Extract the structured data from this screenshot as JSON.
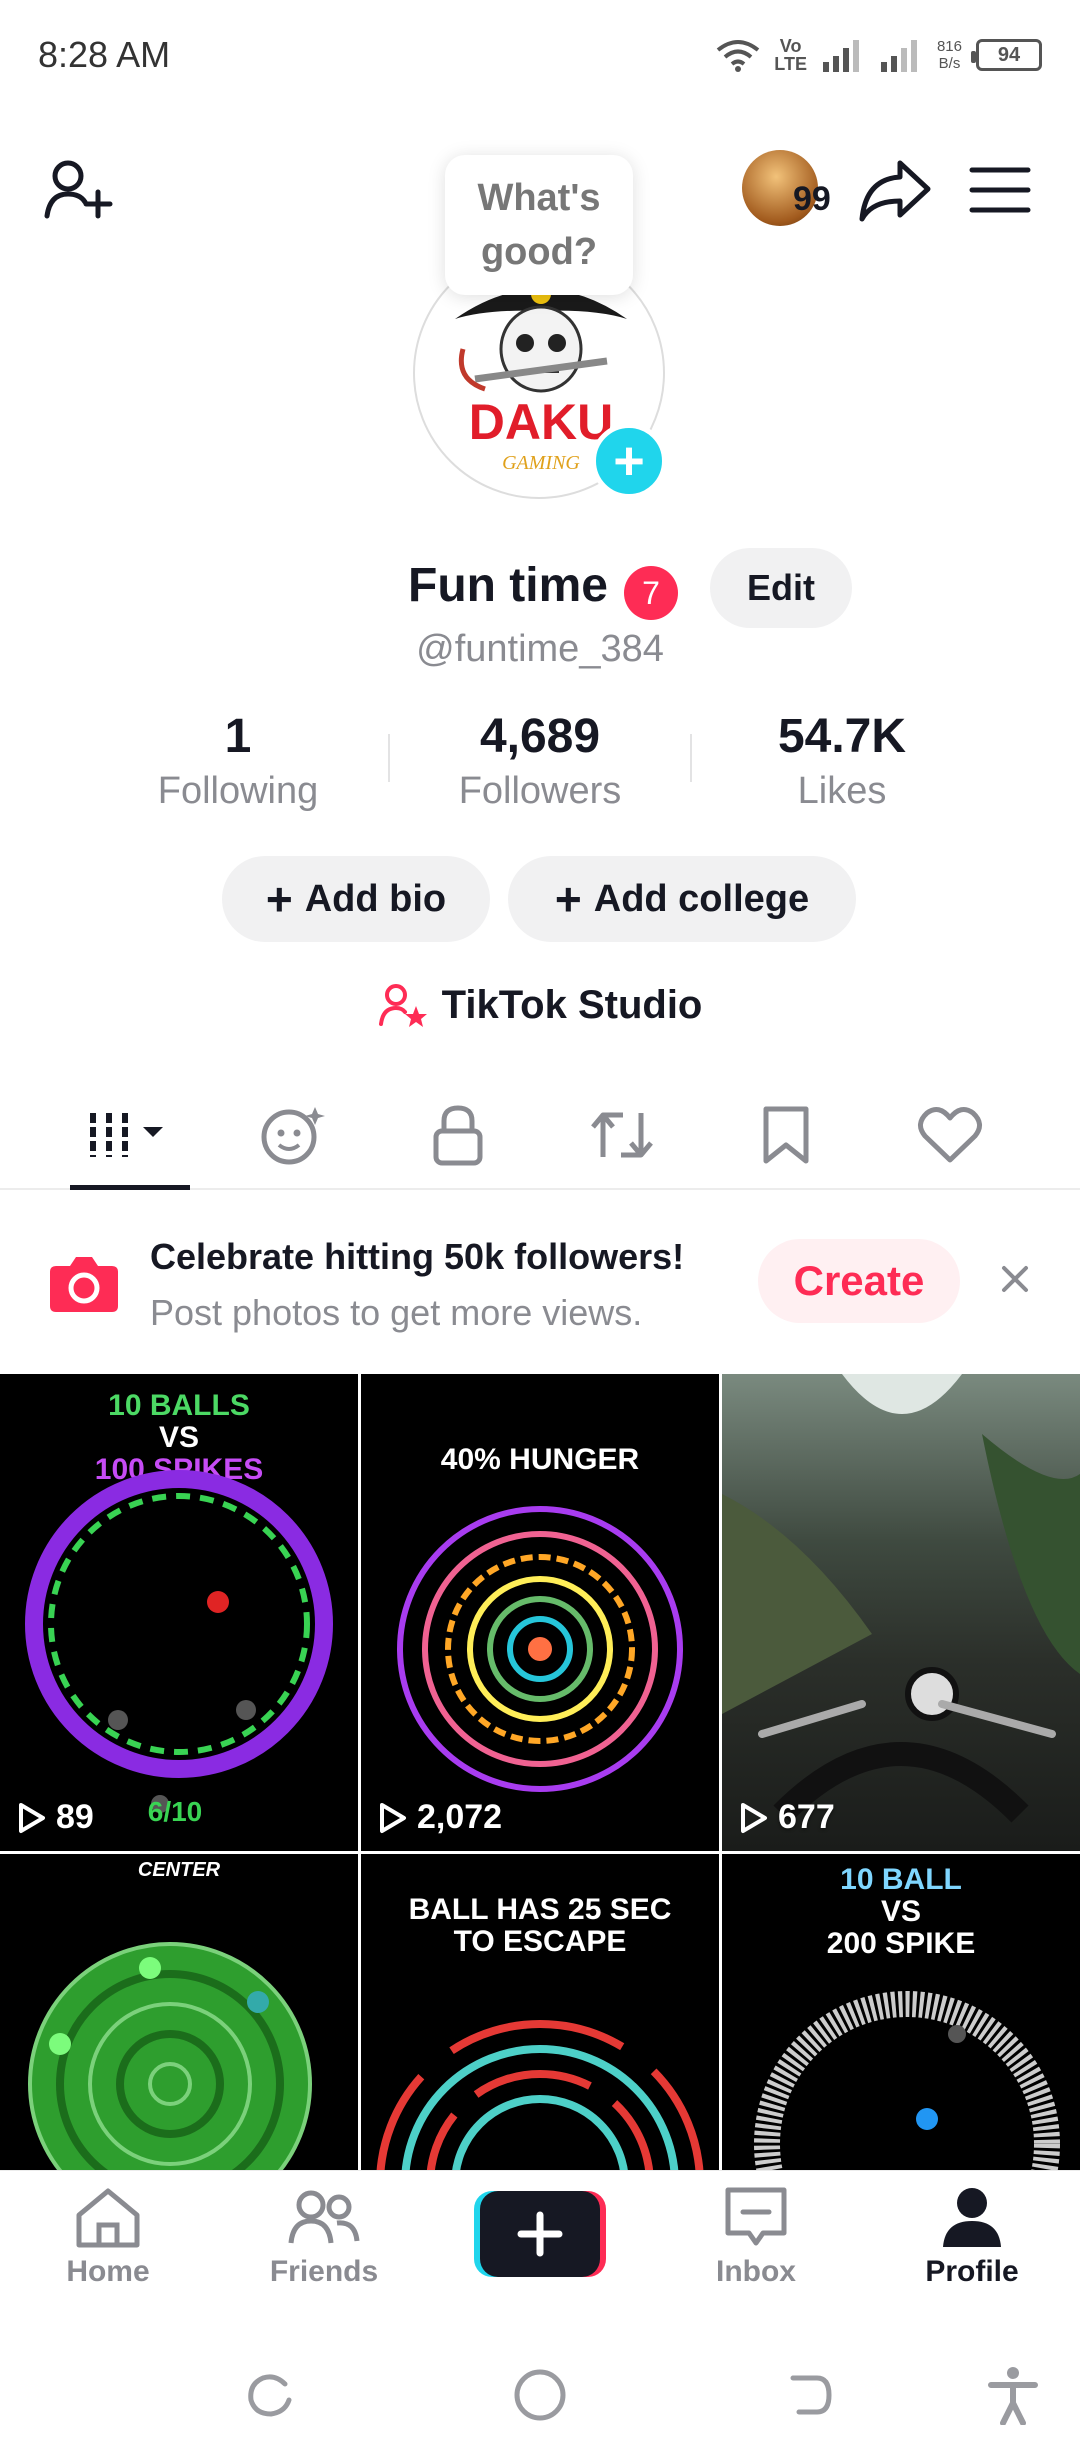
{
  "status_bar": {
    "time": "8:28 AM",
    "network_top": "Vo",
    "network_bottom": "LTE",
    "speed_value": "816",
    "speed_unit": "B/s",
    "battery": "94"
  },
  "header": {
    "avatar_count": "99",
    "bubble_text": "What's good?"
  },
  "profile": {
    "name": "Fun time",
    "badge_count": "7",
    "edit_label": "Edit",
    "username": "@funtime_384",
    "logo_text": "DAKU",
    "logo_sub": "GAMING"
  },
  "stats": [
    {
      "value": "1",
      "label": "Following"
    },
    {
      "value": "4,689",
      "label": "Followers"
    },
    {
      "value": "54.7K",
      "label": "Likes"
    }
  ],
  "actions": {
    "add_bio": "Add bio",
    "add_college": "Add college",
    "studio": "TikTok Studio"
  },
  "tabs": [
    {
      "icon": "grid-icon"
    },
    {
      "icon": "reposts-face-icon"
    },
    {
      "icon": "lock-icon"
    },
    {
      "icon": "repost-icon"
    },
    {
      "icon": "bookmark-icon"
    },
    {
      "icon": "heart-icon"
    }
  ],
  "banner": {
    "title": "Celebrate hitting 50k followers!",
    "subtitle": "Post photos to get more views.",
    "create_label": "Create"
  },
  "videos": [
    {
      "caption_line1": "10 BALLS",
      "caption_line2": "VS",
      "caption_line3": "100 SPIKES",
      "views": "89",
      "overlay": "6/10"
    },
    {
      "caption_line1": "40% HUNGER",
      "views": "2,072"
    },
    {
      "views": "677"
    },
    {
      "caption_line1": "CENTER"
    },
    {
      "caption_line1": "BALL HAS 25 SEC",
      "caption_line2": "TO ESCAPE"
    },
    {
      "caption_line1": "10 BALL",
      "caption_line2": "VS",
      "caption_line3": "200 SPIKE"
    }
  ],
  "bottom_nav": {
    "home": "Home",
    "friends": "Friends",
    "inbox": "Inbox",
    "profile": "Profile"
  },
  "colors": {
    "accent": "#fe2c55",
    "create_cyan": "#20d5ec",
    "text_primary": "#161823",
    "text_secondary": "#8a8b91"
  }
}
